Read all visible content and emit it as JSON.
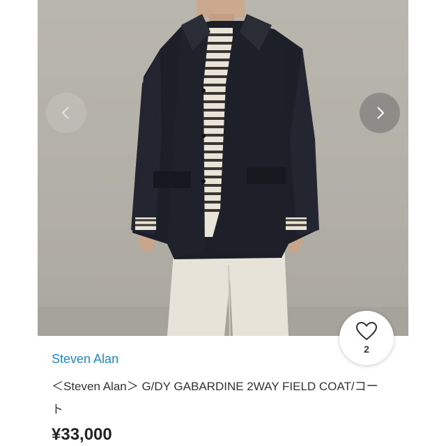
{
  "product": {
    "brand": "Steven Alan",
    "title": "＜Steven Alan＞ G/DY GABARDINE 2WAY FIELD COAT/コート",
    "price": "¥33,000",
    "like_count": "2"
  },
  "icons": {
    "prev": "chevron-left-icon",
    "next": "chevron-right-icon",
    "like": "heart-outline-icon"
  },
  "colors": {
    "brand_link": "#1e88c7",
    "price": "#222222"
  }
}
